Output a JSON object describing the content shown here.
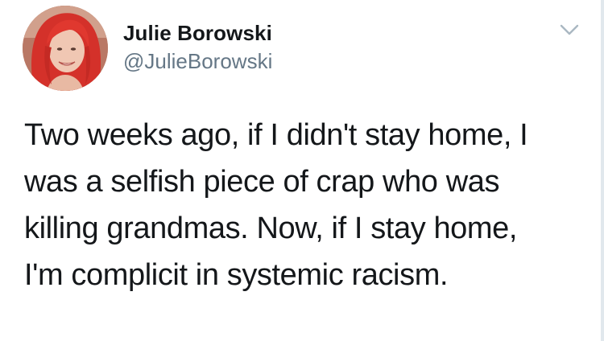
{
  "tweet": {
    "author": {
      "display_name": "Julie Borowski",
      "handle": "@JulieBorowski"
    },
    "text_lines": [
      "Two weeks ago, if I didn't stay home, I",
      "was a selfish piece of crap who was",
      "killing grandmas. Now, if I stay home,",
      "I'm complicit in systemic racism."
    ],
    "menu_icon": "chevron-down-icon",
    "avatar_icon": "profile-photo"
  },
  "colors": {
    "name": "#14171a",
    "handle": "#657786",
    "caret": "#aab8c2",
    "hair": "#d4312a"
  }
}
